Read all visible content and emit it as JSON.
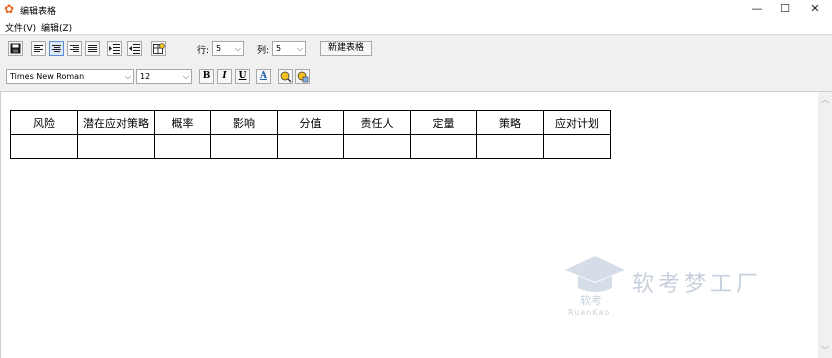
{
  "window": {
    "title": "编辑表格",
    "min": "—",
    "max": "☐",
    "close": "✕"
  },
  "menu": {
    "file": "文件(V)",
    "edit": "编辑(Z)"
  },
  "toolbar": {
    "row_label": "行:",
    "row_value": "5",
    "col_label": "列:",
    "col_value": "5",
    "new_table": "新建表格",
    "font_name": "Times New Roman",
    "font_size": "12",
    "bold": "B",
    "italic": "I",
    "underline": "U",
    "font_color": "A"
  },
  "table": {
    "headers": [
      "风险",
      "潜在应对策略",
      "概率",
      "影响",
      "分值",
      "责任人",
      "定量",
      "策略",
      "应对计划"
    ],
    "rows": [
      [
        "",
        "",
        "",
        "",
        "",
        "",
        "",
        "",
        ""
      ]
    ]
  },
  "watermark": {
    "main": "软考梦工厂",
    "small": "软考",
    "en": "RuanKao"
  }
}
